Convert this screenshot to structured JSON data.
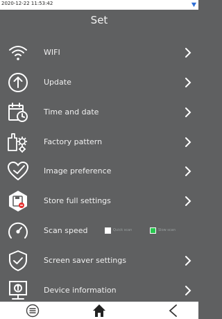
{
  "status": {
    "time": "2020-12-22 11:53:42"
  },
  "header": {
    "title": "Set"
  },
  "menu": [
    {
      "label": "WIFI",
      "icon": "wifi-icon"
    },
    {
      "label": "Update",
      "icon": "update-icon"
    },
    {
      "label": "Time and date",
      "icon": "calendar-clock-icon"
    },
    {
      "label": "Factory pattern",
      "icon": "factory-gears-icon"
    },
    {
      "label": "Image preference",
      "icon": "heart-check-icon"
    },
    {
      "label": "Store full settings",
      "icon": "save-disk-icon"
    },
    {
      "label": "Scan speed",
      "icon": "speedometer-icon"
    },
    {
      "label": "Screen saver settings",
      "icon": "shield-check-icon"
    },
    {
      "label": "Device information",
      "icon": "monitor-info-icon"
    }
  ],
  "scan_speed": {
    "quick_label": "Quick scan",
    "slow_label": "Slow scan",
    "selected": "slow"
  },
  "colors": {
    "background": "#5f6061",
    "accent_green": "#27c64e",
    "text": "#f0f0f0"
  },
  "nav": {
    "icons": [
      "menu-icon",
      "home-icon",
      "back-icon"
    ]
  }
}
